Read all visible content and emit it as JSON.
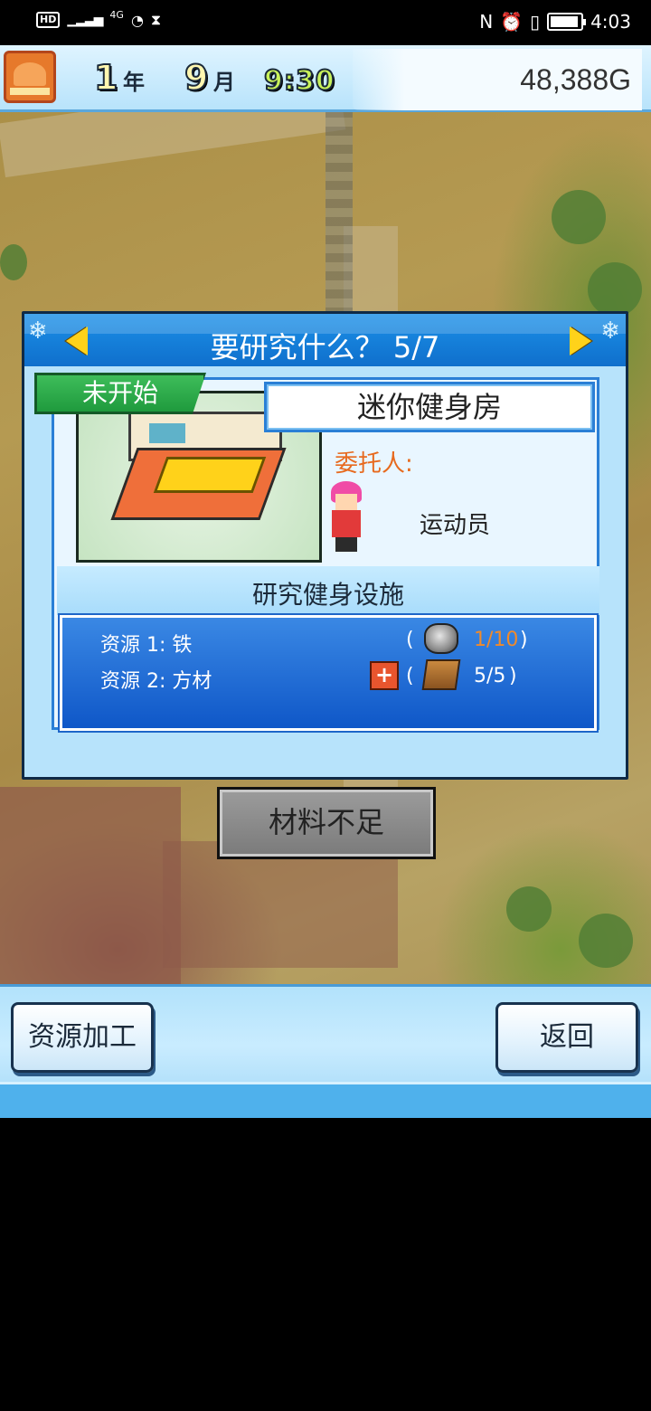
{
  "status_bar": {
    "hd": "HD",
    "network": "4G",
    "time": "4:03"
  },
  "hud": {
    "year_num": "1",
    "year_unit": "年",
    "month_num": "9",
    "month_unit": "月",
    "clock": "9:30",
    "money": "48,388G"
  },
  "dialog": {
    "title": "要研究什么？ 5/7",
    "status_tag": "未开始",
    "item_name": "迷你健身房",
    "client_label": "委托人:",
    "client_name": "运动员",
    "subtitle": "研究健身设施",
    "resources": [
      {
        "label": "资源 1: 铁",
        "icon": "iron-ore-icon",
        "count": "1/10",
        "has_plus": false,
        "status_color": "#f08a2a"
      },
      {
        "label": "资源 2: 方材",
        "icon": "lumber-plank-icon",
        "count": "5/5",
        "has_plus": true,
        "status_color": "#ffffff"
      }
    ],
    "paren_open": "(",
    "paren_close": ")",
    "plus_label": "+"
  },
  "action_button": "材料不足",
  "bottom": {
    "left_button": "资源加工",
    "right_button": "返回"
  }
}
